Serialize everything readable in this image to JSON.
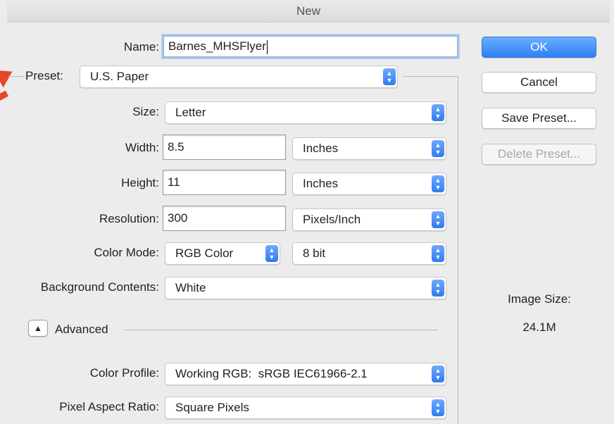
{
  "window": {
    "title": "New"
  },
  "form": {
    "name_label": "Name:",
    "name_value": "Barnes_MHSFlyer",
    "preset_label": "Preset:",
    "preset_value": "U.S. Paper",
    "size_label": "Size:",
    "size_value": "Letter",
    "width_label": "Width:",
    "width_value": "8.5",
    "width_unit": "Inches",
    "height_label": "Height:",
    "height_value": "11",
    "height_unit": "Inches",
    "resolution_label": "Resolution:",
    "resolution_value": "300",
    "resolution_unit": "Pixels/Inch",
    "color_mode_label": "Color Mode:",
    "color_mode_value": "RGB Color",
    "bit_depth_value": "8 bit",
    "background_label": "Background Contents:",
    "background_value": "White",
    "advanced_label": "Advanced",
    "color_profile_label": "Color Profile:",
    "color_profile_value": "Working RGB:  sRGB IEC61966-2.1",
    "pixel_aspect_label": "Pixel Aspect Ratio:",
    "pixel_aspect_value": "Square Pixels"
  },
  "buttons": {
    "ok": "OK",
    "cancel": "Cancel",
    "save_preset": "Save Preset...",
    "delete_preset": "Delete Preset..."
  },
  "info": {
    "image_size_label": "Image Size:",
    "image_size_value": "24.1M"
  },
  "colors": {
    "accent": "#2d7ff5",
    "annotation_arrow": "#e8452b"
  }
}
